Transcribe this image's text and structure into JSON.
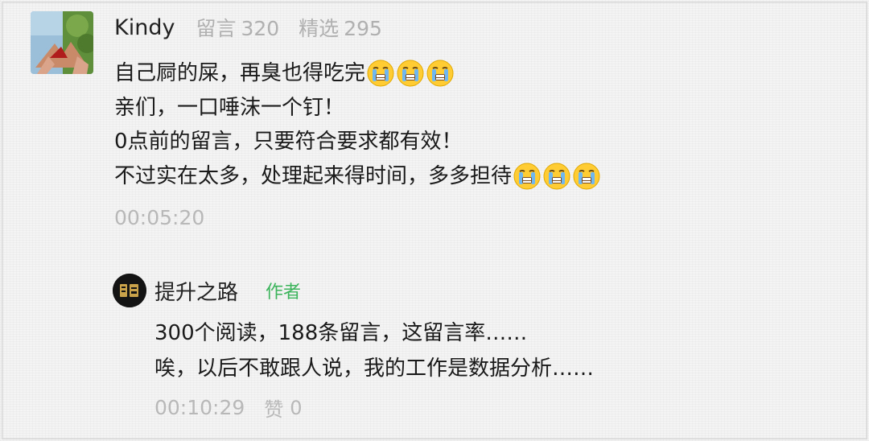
{
  "comment": {
    "username": "Kindy",
    "stats": {
      "comments_label": "留言",
      "comments_count": "320",
      "featured_label": "精选",
      "featured_count": "295"
    },
    "lines": [
      "自己屙的屎，再臭也得吃完",
      "亲们，一口唾沫一个钉！",
      "0点前的留言，只要符合要求都有效！",
      "不过实在太多，处理起来得时间，多多担待"
    ],
    "emoji_icon": "crying-face-emoji",
    "timestamp": "00:05:20"
  },
  "reply": {
    "name": "提升之路",
    "author_tag": "作者",
    "lines": [
      "300个阅读，188条留言，这留言率……",
      "唉，以后不敢跟人说，我的工作是数据分析……"
    ],
    "timestamp": "00:10:29",
    "like_label": "赞",
    "like_count": "0"
  },
  "colors": {
    "author_tag": "#3cb45c",
    "muted_text": "#b8b8b8",
    "primary_text": "#1a1a1a"
  }
}
